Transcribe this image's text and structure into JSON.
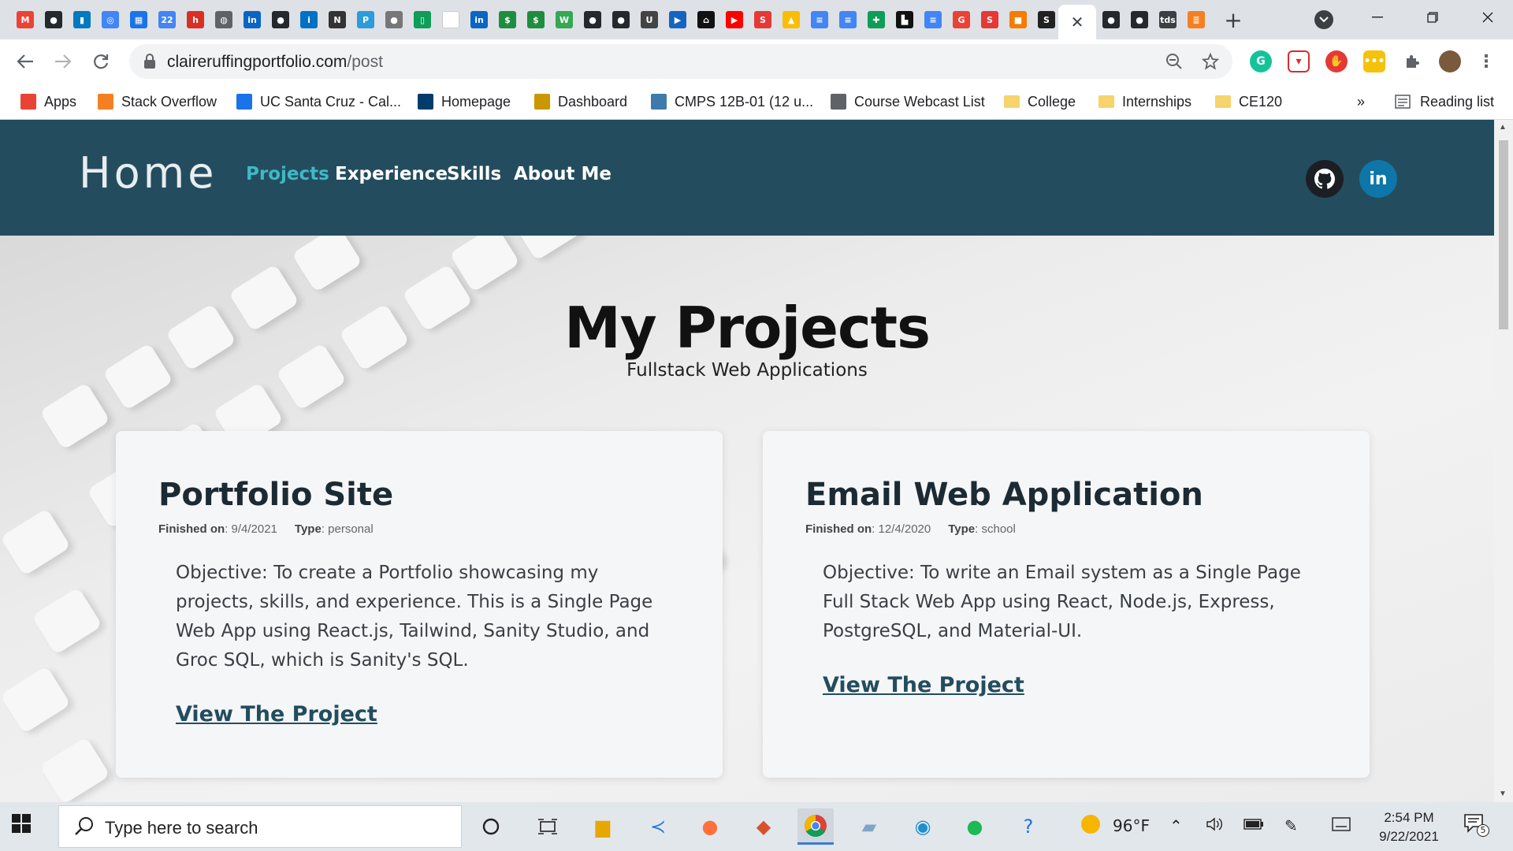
{
  "browser": {
    "tab_icons": [
      {
        "name": "gmail-icon",
        "glyph": "M",
        "color": "#ea4335"
      },
      {
        "name": "github-icon",
        "glyph": "●",
        "color": "#24292e"
      },
      {
        "name": "trello-icon",
        "glyph": "▮",
        "color": "#0079bf"
      },
      {
        "name": "chrome-app-icon",
        "glyph": "◎",
        "color": "#4285f4"
      },
      {
        "name": "calendar-app-icon",
        "glyph": "▦",
        "color": "#1a73e8"
      },
      {
        "name": "calendar-22-icon",
        "glyph": "22",
        "color": "#4285f4"
      },
      {
        "name": "handshake-icon",
        "glyph": "h",
        "color": "#d93025"
      },
      {
        "name": "globe-icon",
        "glyph": "◍",
        "color": "#5f6368"
      },
      {
        "name": "linkedin-icon",
        "glyph": "in",
        "color": "#0a66c2"
      },
      {
        "name": "github-icon",
        "glyph": "●",
        "color": "#24292e"
      },
      {
        "name": "intel-icon",
        "glyph": "i",
        "color": "#0071c5"
      },
      {
        "name": "notion-icon",
        "glyph": "N",
        "color": "#333333"
      },
      {
        "name": "pinterest-icon",
        "glyph": "P",
        "color": "#2d9cdb"
      },
      {
        "name": "apple-icon",
        "glyph": "●",
        "color": "#777777"
      },
      {
        "name": "sheet-icon",
        "glyph": "▯",
        "color": "#0f9d58"
      },
      {
        "name": "blank-page-icon",
        "glyph": " ",
        "color": "#ffffff"
      },
      {
        "name": "linkedin-icon",
        "glyph": "in",
        "color": "#0a66c2"
      },
      {
        "name": "green-badge-icon",
        "glyph": "$",
        "color": "#1e8e3e"
      },
      {
        "name": "green-badge-icon",
        "glyph": "$",
        "color": "#1e8e3e"
      },
      {
        "name": "w-icon",
        "glyph": "W",
        "color": "#34a853"
      },
      {
        "name": "github-icon",
        "glyph": "●",
        "color": "#24292e"
      },
      {
        "name": "github-icon",
        "glyph": "●",
        "color": "#24292e"
      },
      {
        "name": "u-icon",
        "glyph": "U",
        "color": "#444444"
      },
      {
        "name": "video-icon",
        "glyph": "▶",
        "color": "#1565c0"
      },
      {
        "name": "code-icon",
        "glyph": "⌂",
        "color": "#111111"
      },
      {
        "name": "youtube-icon",
        "glyph": "▶",
        "color": "#ff0000"
      },
      {
        "name": "s-red-icon",
        "glyph": "S",
        "color": "#e53935"
      },
      {
        "name": "drive-icon",
        "glyph": "▲",
        "color": "#fbbc04"
      },
      {
        "name": "docs-icon",
        "glyph": "≡",
        "color": "#4285f4"
      },
      {
        "name": "docs-icon",
        "glyph": "≡",
        "color": "#4285f4"
      },
      {
        "name": "plus-green-icon",
        "glyph": "✚",
        "color": "#0f9d58"
      },
      {
        "name": "blackboard-icon",
        "glyph": "▙",
        "color": "#111111"
      },
      {
        "name": "docs-icon",
        "glyph": "≡",
        "color": "#4285f4"
      },
      {
        "name": "google-icon",
        "glyph": "G",
        "color": "#ea4335"
      },
      {
        "name": "s-circle-icon",
        "glyph": "S",
        "color": "#e53935"
      },
      {
        "name": "box-icon",
        "glyph": "■",
        "color": "#f57c00"
      },
      {
        "name": "s-black-icon",
        "glyph": "S",
        "color": "#222222"
      }
    ],
    "tab_icons_after": [
      {
        "name": "github-icon",
        "glyph": "●",
        "color": "#24292e"
      },
      {
        "name": "github-icon",
        "glyph": "●",
        "color": "#24292e"
      },
      {
        "name": "tds-icon",
        "glyph": "tds",
        "color": "#3c4043"
      },
      {
        "name": "stackoverflow-icon",
        "glyph": "≣",
        "color": "#f48024"
      }
    ],
    "active_tab_close": "✕",
    "new_tab": "+",
    "url_host": "claireruffingportfolio.com",
    "url_path": "/post",
    "bookmarks": [
      {
        "label": "Apps",
        "icon": "apps-grid-icon",
        "color": "#ea4335"
      },
      {
        "label": "Stack Overflow",
        "icon": "stackoverflow-icon",
        "color": "#f48024"
      },
      {
        "label": "UC Santa Cruz - Cal...",
        "icon": "calendar-icon",
        "color": "#1a73e8"
      },
      {
        "label": "Homepage",
        "icon": "ucsc-icon",
        "color": "#003c6c"
      },
      {
        "label": "Dashboard",
        "icon": "ucsc-gold-icon",
        "color": "#c99700"
      },
      {
        "label": "CMPS 12B-01 (12 u...",
        "icon": "piazza-icon",
        "color": "#3e7aab"
      },
      {
        "label": "Course Webcast List",
        "icon": "globe-icon",
        "color": "#5f6368"
      },
      {
        "label": "College",
        "icon": "folder-icon",
        "color": "#f6d36b"
      },
      {
        "label": "Internships",
        "icon": "folder-icon",
        "color": "#f6d36b"
      },
      {
        "label": "CE120",
        "icon": "folder-icon",
        "color": "#f6d36b"
      }
    ],
    "bookmarks_overflow": "»",
    "reading_list": "Reading list"
  },
  "site": {
    "brand": "Home",
    "nav": [
      {
        "label": "Projects",
        "active": true
      },
      {
        "label": "Experience",
        "active": false
      },
      {
        "label": "Skills",
        "active": false
      },
      {
        "label": "About Me",
        "active": false
      }
    ],
    "linkedin_label": "in",
    "accent_color": "#3fb8c7",
    "nav_bg": "#234d5e"
  },
  "main": {
    "title": "My Projects",
    "subtitle": "Fullstack Web Applications",
    "projects": [
      {
        "title": "Portfolio Site",
        "finished_label": "Finished on",
        "finished": "9/4/2021",
        "type_label": "Type",
        "type": "personal",
        "description": "Objective: To create a Portfolio showcasing my projects, skills, and experience. This is a Single Page Web App using React.js, Tailwind, Sanity Studio, and Groc SQL, which is Sanity's SQL.",
        "link": "View The Project"
      },
      {
        "title": "Email Web Application",
        "finished_label": "Finished on",
        "finished": "12/4/2020",
        "type_label": "Type",
        "type": "school",
        "description": "Objective: To write an Email system as a Single Page Full Stack Web App using React, Node.js, Express, PostgreSQL, and Material-UI.",
        "link": "View The Project"
      }
    ]
  },
  "taskbar": {
    "search_placeholder": "Type here to search",
    "weather": "96°F",
    "time": "2:54 PM",
    "date": "9/22/2021",
    "notifications": "5"
  }
}
